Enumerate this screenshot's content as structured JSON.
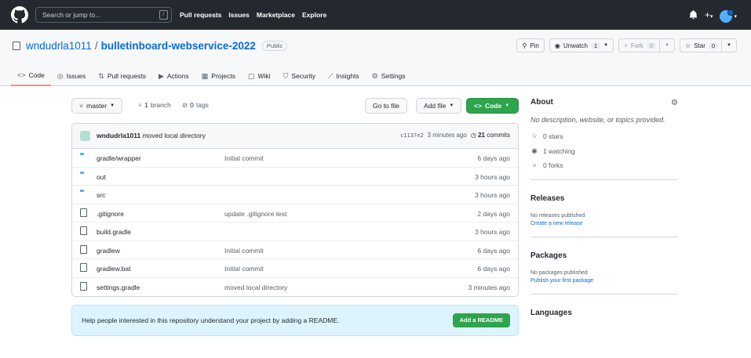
{
  "header": {
    "search_placeholder": "Search or jump to...",
    "search_shortcut": "/",
    "nav": [
      "Pull requests",
      "Issues",
      "Marketplace",
      "Explore"
    ],
    "plus": "+"
  },
  "repo": {
    "owner": "wndudrla1011",
    "separator": "/",
    "name": "bulletinboard-webservice-2022",
    "visibility": "Public",
    "actions": {
      "pin": "Pin",
      "unwatch": "Unwatch",
      "unwatch_count": "1",
      "fork": "Fork",
      "fork_count": "0",
      "star": "Star",
      "star_count": "0"
    },
    "tabs": [
      {
        "label": "Code",
        "icon": "<>"
      },
      {
        "label": "Issues",
        "icon": "◎"
      },
      {
        "label": "Pull requests",
        "icon": "⇅"
      },
      {
        "label": "Actions",
        "icon": "▶"
      },
      {
        "label": "Projects",
        "icon": "▦"
      },
      {
        "label": "Wiki",
        "icon": "▢"
      },
      {
        "label": "Security",
        "icon": "⛉"
      },
      {
        "label": "Insights",
        "icon": "⟋"
      },
      {
        "label": "Settings",
        "icon": "⚙"
      }
    ]
  },
  "branchbar": {
    "branch": "master",
    "branches_count": "1",
    "branches_label": "branch",
    "tags_count": "0",
    "tags_label": "tags",
    "goto_file": "Go to file",
    "add_file": "Add file",
    "code": "Code"
  },
  "commit": {
    "author": "wndudrla1011",
    "message": "moved local directory",
    "hash": "c1137e2",
    "time": "3 minutes ago",
    "commits_count": "21",
    "commits_label": "commits"
  },
  "files": [
    {
      "type": "dir",
      "name": "gradle/wrapper",
      "message": "Initial commit",
      "time": "6 days ago"
    },
    {
      "type": "dir",
      "name": "out",
      "message": "",
      "time": "3 hours ago"
    },
    {
      "type": "dir",
      "name": "src",
      "message": "",
      "time": "3 hours ago"
    },
    {
      "type": "file",
      "name": ".gitignore",
      "message": "update .gitignore test",
      "time": "2 days ago"
    },
    {
      "type": "file",
      "name": "build.gradle",
      "message": "",
      "time": "3 hours ago"
    },
    {
      "type": "file",
      "name": "gradlew",
      "message": "Initial commit",
      "time": "6 days ago"
    },
    {
      "type": "file",
      "name": "gradlew.bat",
      "message": "Initial commit",
      "time": "6 days ago"
    },
    {
      "type": "file",
      "name": "settings.gradle",
      "message": "moved local directory",
      "time": "3 minutes ago"
    }
  ],
  "readme": {
    "text": "Help people interested in this repository understand your project by adding a README.",
    "button": "Add a README"
  },
  "sidebar": {
    "about_title": "About",
    "description": "No description, website, or topics provided.",
    "stars": "0 stars",
    "watching": "1 watching",
    "forks": "0 forks",
    "releases_title": "Releases",
    "releases_none": "No releases published",
    "releases_link": "Create a new release",
    "packages_title": "Packages",
    "packages_none": "No packages published",
    "packages_link": "Publish your first package",
    "languages_title": "Languages"
  }
}
